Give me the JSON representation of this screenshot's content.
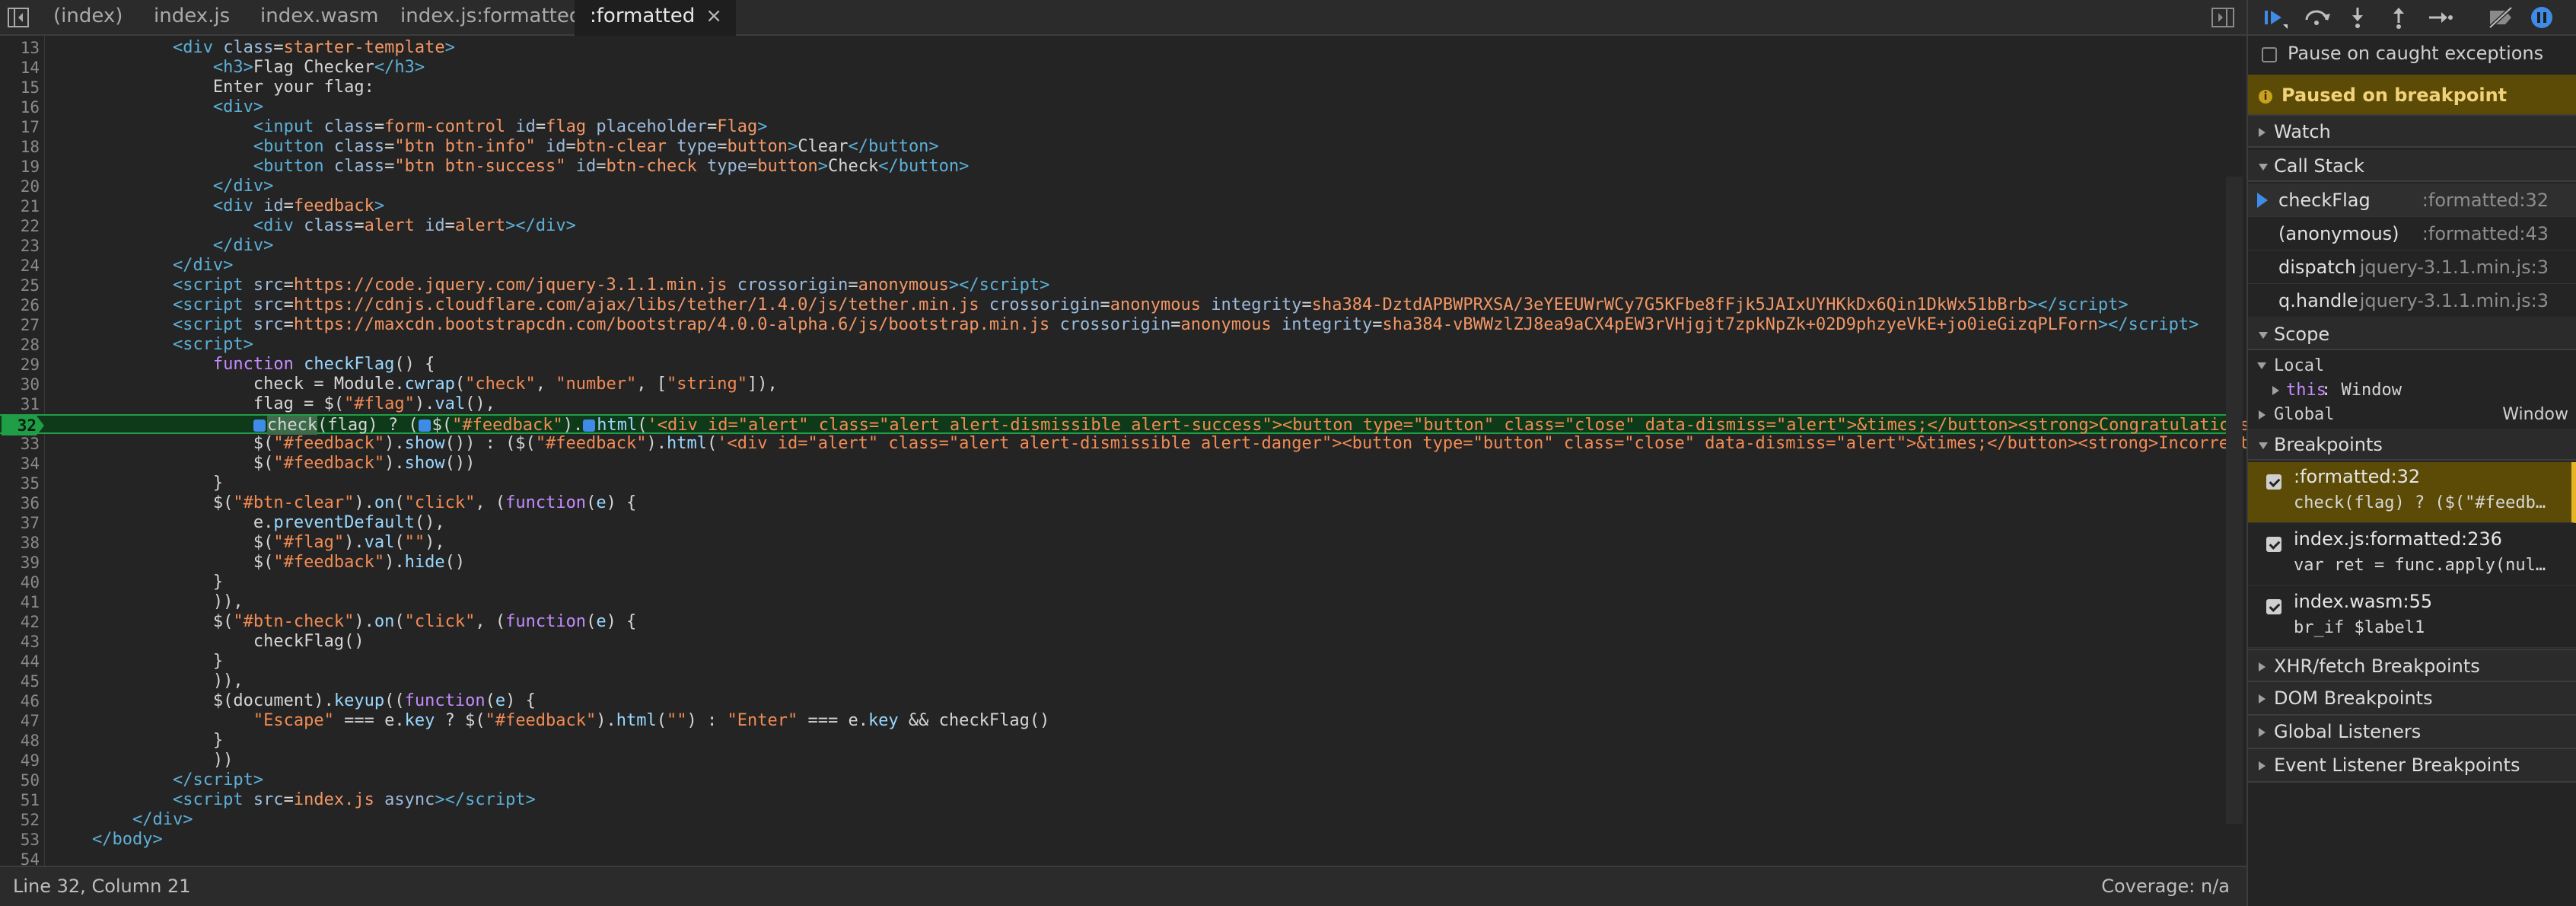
{
  "tabs": [
    {
      "label": "(index)",
      "active": false
    },
    {
      "label": "index.js",
      "active": false
    },
    {
      "label": "index.wasm",
      "active": false
    },
    {
      "label": "index.js:formatted",
      "active": false
    },
    {
      "label": ":formatted",
      "active": true
    }
  ],
  "tab_close_glyph": "×",
  "code": {
    "breakpoint_line": 32,
    "lines": [
      {
        "n": "13",
        "html": "            <span class=\"tag\">&lt;div</span> <span class=\"attr\">class</span>=<span class=\"aval\">starter-template</span><span class=\"tag\">&gt;</span>"
      },
      {
        "n": "14",
        "html": "                <span class=\"tag\">&lt;h3&gt;</span>Flag Checker<span class=\"tag\">&lt;/h3&gt;</span>"
      },
      {
        "n": "15",
        "html": "                Enter your flag:"
      },
      {
        "n": "16",
        "html": "                <span class=\"tag\">&lt;div&gt;</span>"
      },
      {
        "n": "17",
        "html": "                    <span class=\"tag\">&lt;input</span> <span class=\"attr\">class</span>=<span class=\"aval\">form-control</span> <span class=\"attr\">id</span>=<span class=\"aval\">flag</span> <span class=\"attr\">placeholder</span>=<span class=\"aval\">Flag</span><span class=\"tag\">&gt;</span>"
      },
      {
        "n": "18",
        "html": "                    <span class=\"tag\">&lt;button</span> <span class=\"attr\">class</span>=<span class=\"aval\">\"btn btn-info\"</span> <span class=\"attr\">id</span>=<span class=\"aval\">btn-clear</span> <span class=\"attr\">type</span>=<span class=\"aval\">button</span><span class=\"tag\">&gt;</span>Clear<span class=\"tag\">&lt;/button&gt;</span>"
      },
      {
        "n": "19",
        "html": "                    <span class=\"tag\">&lt;button</span> <span class=\"attr\">class</span>=<span class=\"aval\">\"btn btn-success\"</span> <span class=\"attr\">id</span>=<span class=\"aval\">btn-check</span> <span class=\"attr\">type</span>=<span class=\"aval\">button</span><span class=\"tag\">&gt;</span>Check<span class=\"tag\">&lt;/button&gt;</span>"
      },
      {
        "n": "20",
        "html": "                <span class=\"tag\">&lt;/div&gt;</span>"
      },
      {
        "n": "21",
        "html": "                <span class=\"tag\">&lt;div</span> <span class=\"attr\">id</span>=<span class=\"aval\">feedback</span><span class=\"tag\">&gt;</span>"
      },
      {
        "n": "22",
        "html": "                    <span class=\"tag\">&lt;div</span> <span class=\"attr\">class</span>=<span class=\"aval\">alert</span> <span class=\"attr\">id</span>=<span class=\"aval\">alert</span><span class=\"tag\">&gt;&lt;/div&gt;</span>"
      },
      {
        "n": "23",
        "html": "                <span class=\"tag\">&lt;/div&gt;</span>"
      },
      {
        "n": "24",
        "html": "            <span class=\"tag\">&lt;/div&gt;</span>"
      },
      {
        "n": "25",
        "html": "            <span class=\"tag\">&lt;script</span> <span class=\"attr\">src</span>=<span class=\"aval\">https://code.jquery.com/jquery-3.1.1.min.js</span> <span class=\"attr\">crossorigin</span>=<span class=\"aval\">anonymous</span><span class=\"tag\">&gt;&lt;/script&gt;</span>"
      },
      {
        "n": "26",
        "html": "            <span class=\"tag\">&lt;script</span> <span class=\"attr\">src</span>=<span class=\"aval\">https://cdnjs.cloudflare.com/ajax/libs/tether/1.4.0/js/tether.min.js</span> <span class=\"attr\">crossorigin</span>=<span class=\"aval\">anonymous</span> <span class=\"attr\">integrity</span>=<span class=\"aval\">sha384-DztdAPBWPRXSA/3eYEEUWrWCy7G5KFbe8fFjk5JAIxUYHKkDx6Qin1DkWx51bBrb</span><span class=\"tag\">&gt;&lt;/script&gt;</span>"
      },
      {
        "n": "27",
        "html": "            <span class=\"tag\">&lt;script</span> <span class=\"attr\">src</span>=<span class=\"aval\">https://maxcdn.bootstrapcdn.com/bootstrap/4.0.0-alpha.6/js/bootstrap.min.js</span> <span class=\"attr\">crossorigin</span>=<span class=\"aval\">anonymous</span> <span class=\"attr\">integrity</span>=<span class=\"aval\">sha384-vBWWzlZJ8ea9aCX4pEW3rVHjgjt7zpkNpZk+02D9phzyeVkE+jo0ieGizqPLForn</span><span class=\"tag\">&gt;&lt;/script&gt;</span>"
      },
      {
        "n": "28",
        "html": "            <span class=\"tag\">&lt;script&gt;</span>"
      },
      {
        "n": "29",
        "html": "                <span class=\"kw\">function</span> <span class=\"cyan\">checkFlag</span>() {"
      },
      {
        "n": "30",
        "html": "                    check = Module.<span class=\"cyan\">cwrap</span>(<span class=\"str\">\"check\"</span>, <span class=\"str\">\"number\"</span>, [<span class=\"str\">\"string\"</span>]),"
      },
      {
        "n": "31",
        "html": "                    flag = $(<span class=\"str\">\"#flag\"</span>).<span class=\"cyan\">val</span>(),"
      },
      {
        "n": "32",
        "html": "                    <span class=\"mk\"></span><span class=\"hl\">check</span>(flag) ? (<span class=\"mk\"></span>$(<span class=\"str\">\"#feedback\"</span>).<span class=\"mk\"></span><span class=\"cyan\">html</span>(<span class=\"str\">'&lt;div id=\"alert\" class=\"alert alert-dismissible alert-success\"&gt;&lt;button type=\"button\" class=\"close\" data-dismiss=\"alert\"&gt;&amp;times;&lt;/button&gt;&lt;strong&gt;Congratulations</span>"
      },
      {
        "n": "33",
        "html": "                    $(<span class=\"str\">\"#feedback\"</span>).<span class=\"cyan\">show</span>()) : ($(<span class=\"str\">\"#feedback\"</span>).<span class=\"cyan\">html</span>(<span class=\"str\">'&lt;div id=\"alert\" class=\"alert alert-dismissible alert-danger\"&gt;&lt;button type=\"button\" class=\"close\" data-dismiss=\"alert\"&gt;&amp;times;&lt;/button&gt;&lt;strong&gt;Incorrect</span>"
      },
      {
        "n": "34",
        "html": "                    $(<span class=\"str\">\"#feedback\"</span>).<span class=\"cyan\">show</span>())"
      },
      {
        "n": "35",
        "html": "                }"
      },
      {
        "n": "36",
        "html": "                $(<span class=\"str\">\"#btn-clear\"</span>).<span class=\"cyan\">on</span>(<span class=\"str\">\"click\"</span>, (<span class=\"kw\">function</span>(<span class=\"cyan\">e</span>) {"
      },
      {
        "n": "37",
        "html": "                    e.<span class=\"cyan\">preventDefault</span>(),"
      },
      {
        "n": "38",
        "html": "                    $(<span class=\"str\">\"#flag\"</span>).<span class=\"cyan\">val</span>(<span class=\"str\">\"\"</span>),"
      },
      {
        "n": "39",
        "html": "                    $(<span class=\"str\">\"#feedback\"</span>).<span class=\"cyan\">hide</span>()"
      },
      {
        "n": "40",
        "html": "                }"
      },
      {
        "n": "41",
        "html": "                )),"
      },
      {
        "n": "42",
        "html": "                $(<span class=\"str\">\"#btn-check\"</span>).<span class=\"cyan\">on</span>(<span class=\"str\">\"click\"</span>, (<span class=\"kw\">function</span>(<span class=\"cyan\">e</span>) {"
      },
      {
        "n": "43",
        "html": "                    checkFlag()"
      },
      {
        "n": "44",
        "html": "                }"
      },
      {
        "n": "45",
        "html": "                )),"
      },
      {
        "n": "46",
        "html": "                $(document).<span class=\"cyan\">keyup</span>((<span class=\"kw\">function</span>(<span class=\"cyan\">e</span>) {"
      },
      {
        "n": "47",
        "html": "                    <span class=\"str\">\"Escape\"</span> === e.<span class=\"cyan\">key</span> ? $(<span class=\"str\">\"#feedback\"</span>).<span class=\"cyan\">html</span>(<span class=\"str\">\"\"</span>) : <span class=\"str\">\"Enter\"</span> === e.<span class=\"cyan\">key</span> &amp;&amp; checkFlag()"
      },
      {
        "n": "48",
        "html": "                }"
      },
      {
        "n": "49",
        "html": "                ))"
      },
      {
        "n": "50",
        "html": "            <span class=\"tag\">&lt;/script&gt;</span>"
      },
      {
        "n": "51",
        "html": "            <span class=\"tag\">&lt;script</span> <span class=\"attr\">src</span>=<span class=\"aval\">index.js</span> <span class=\"attr\">async</span><span class=\"tag\">&gt;&lt;/script&gt;</span>"
      },
      {
        "n": "52",
        "html": "        <span class=\"tag\">&lt;/div&gt;</span>"
      },
      {
        "n": "53",
        "html": "    <span class=\"tag\">&lt;/body&gt;</span>"
      },
      {
        "n": "54",
        "html": ""
      }
    ]
  },
  "status": {
    "position": "Line 32, Column 21",
    "coverage": "Coverage: n/a"
  },
  "debugger": {
    "pause_on_caught": "Pause on caught exceptions",
    "paused_message": "Paused on breakpoint",
    "sections": {
      "watch": "Watch",
      "call_stack": "Call Stack",
      "scope": "Scope",
      "breakpoints": "Breakpoints",
      "xhr": "XHR/fetch Breakpoints",
      "dom": "DOM Breakpoints",
      "global_listeners": "Global Listeners",
      "event_listener": "Event Listener Breakpoints"
    },
    "call_stack": [
      {
        "name": "checkFlag",
        "location": ":formatted:32",
        "current": true
      },
      {
        "name": "(anonymous)",
        "location": ":formatted:43",
        "current": false
      },
      {
        "name": "dispatch",
        "location": "jquery-3.1.1.min.js:3",
        "current": false
      },
      {
        "name": "q.handle",
        "location": "jquery-3.1.1.min.js:3",
        "current": false
      }
    ],
    "scope": {
      "local_label": "Local",
      "this_key": "this",
      "this_value": ": Window",
      "global_label": "Global",
      "global_value": "Window"
    },
    "breakpoints": [
      {
        "location": ":formatted:32",
        "code": "check(flag) ? ($(\"#feedba…",
        "active": true
      },
      {
        "location": "index.js:formatted:236",
        "code": "var ret = func.apply(null…",
        "active": false
      },
      {
        "location": "index.wasm:55",
        "code": "br_if $label1",
        "active": false
      }
    ]
  }
}
